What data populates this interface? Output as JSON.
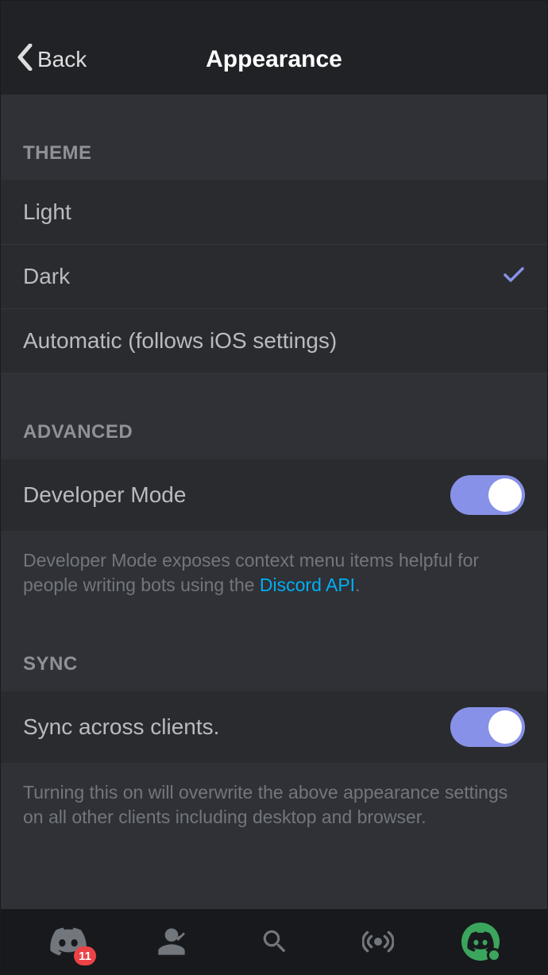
{
  "header": {
    "back_label": "Back",
    "title": "Appearance"
  },
  "sections": {
    "theme": {
      "header": "THEME",
      "items": [
        {
          "label": "Light",
          "selected": false
        },
        {
          "label": "Dark",
          "selected": true
        },
        {
          "label": "Automatic (follows iOS settings)",
          "selected": false
        }
      ]
    },
    "advanced": {
      "header": "ADVANCED",
      "toggle": {
        "label": "Developer Mode",
        "enabled": true
      },
      "description_pre": "Developer Mode exposes context menu items helpful for people writing bots using the ",
      "description_link": "Discord API",
      "description_post": "."
    },
    "sync": {
      "header": "SYNC",
      "toggle": {
        "label": "Sync across clients.",
        "enabled": true
      },
      "description": "Turning this on will overwrite the above appearance settings on all other clients including desktop and browser."
    }
  },
  "tabbar": {
    "badge_count": "11"
  }
}
